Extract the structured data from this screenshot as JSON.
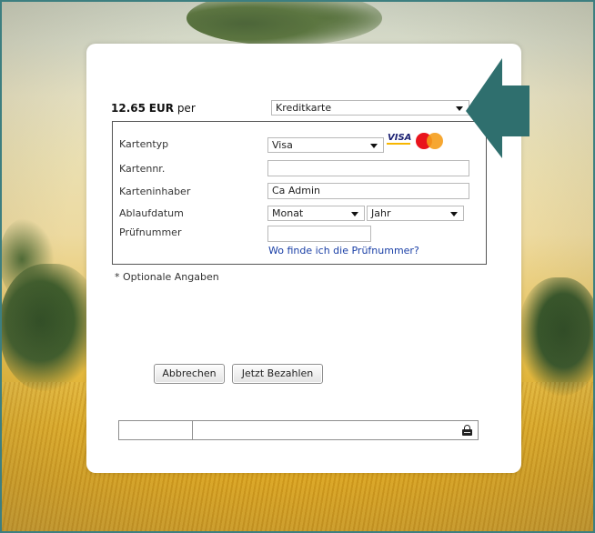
{
  "payment": {
    "amount": "12.65",
    "currency": "EUR",
    "per": "per",
    "method": "Kreditkarte"
  },
  "card": {
    "type_label": "Kartentyp",
    "type_value": "Visa",
    "number_label": "Kartennr.",
    "number_value": "",
    "holder_label": "Karteninhaber",
    "holder_value": "Ca Admin",
    "expiry_label": "Ablaufdatum",
    "expiry_month": "Monat",
    "expiry_year": "Jahr",
    "cvv_label": "Prüfnummer",
    "cvv_value": "",
    "cvv_help_link": "Wo finde ich die Prüfnummer?",
    "logos": {
      "visa": "VISA",
      "mastercard": "mastercard"
    }
  },
  "optional_note": "* Optionale Angaben",
  "buttons": {
    "cancel": "Abbrechen",
    "pay": "Jetzt Bezahlen"
  },
  "colors": {
    "arrow": "#2f6f6e",
    "link": "#1a3fa6",
    "frame": "#3d7f80"
  },
  "icons": {
    "lock": "lock-icon",
    "dropdown": "chevron-down-icon",
    "pointer": "arrow-left-icon"
  }
}
